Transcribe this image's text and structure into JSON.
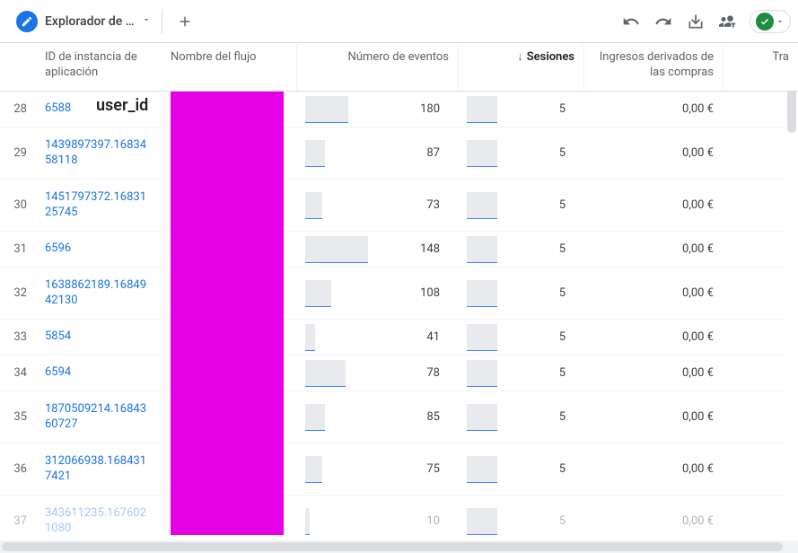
{
  "toolbar": {
    "tab_title": "Explorador de ...",
    "user_id_label": "user_id"
  },
  "columns": {
    "id": "ID de instancia de aplicación",
    "flow": "Nombre del flujo",
    "events": "Número de eventos",
    "sessions": "Sesiones",
    "revenue": "Ingresos derivados de las compras",
    "trans": "Tra"
  },
  "rows": [
    {
      "idx": 28,
      "id": "6588",
      "events": 180,
      "ev_w": 30,
      "sessions": 5,
      "ses_w": 28,
      "revenue": "0,00 €",
      "tall": false
    },
    {
      "idx": 29,
      "id": "1439897397.1683458118",
      "events": 87,
      "ev_w": 14,
      "sessions": 5,
      "ses_w": 28,
      "revenue": "0,00 €",
      "tall": true
    },
    {
      "idx": 30,
      "id": "1451797372.1683125745",
      "events": 73,
      "ev_w": 12,
      "sessions": 5,
      "ses_w": 28,
      "revenue": "0,00 €",
      "tall": true
    },
    {
      "idx": 31,
      "id": "6596",
      "events": 148,
      "ev_w": 44,
      "sessions": 5,
      "ses_w": 28,
      "revenue": "0,00 €",
      "tall": false
    },
    {
      "idx": 32,
      "id": "1638862189.1684942130",
      "events": 108,
      "ev_w": 18,
      "sessions": 5,
      "ses_w": 28,
      "revenue": "0,00 €",
      "tall": true
    },
    {
      "idx": 33,
      "id": "5854",
      "events": 41,
      "ev_w": 7,
      "sessions": 5,
      "ses_w": 28,
      "revenue": "0,00 €",
      "tall": false
    },
    {
      "idx": 34,
      "id": "6594",
      "events": 78,
      "ev_w": 28,
      "sessions": 5,
      "ses_w": 28,
      "revenue": "0,00 €",
      "tall": false
    },
    {
      "idx": 35,
      "id": "1870509214.1684360727",
      "events": 85,
      "ev_w": 14,
      "sessions": 5,
      "ses_w": 28,
      "revenue": "0,00 €",
      "tall": true
    },
    {
      "idx": 36,
      "id": "312066938.1684317421",
      "events": 75,
      "ev_w": 12,
      "sessions": 5,
      "ses_w": 28,
      "revenue": "0,00 €",
      "tall": true
    },
    {
      "idx": 37,
      "id": "343611235.1676021080",
      "events": 10,
      "ev_w": 3,
      "sessions": 5,
      "ses_w": 28,
      "revenue": "0,00 €",
      "tall": true,
      "dim": true
    }
  ]
}
